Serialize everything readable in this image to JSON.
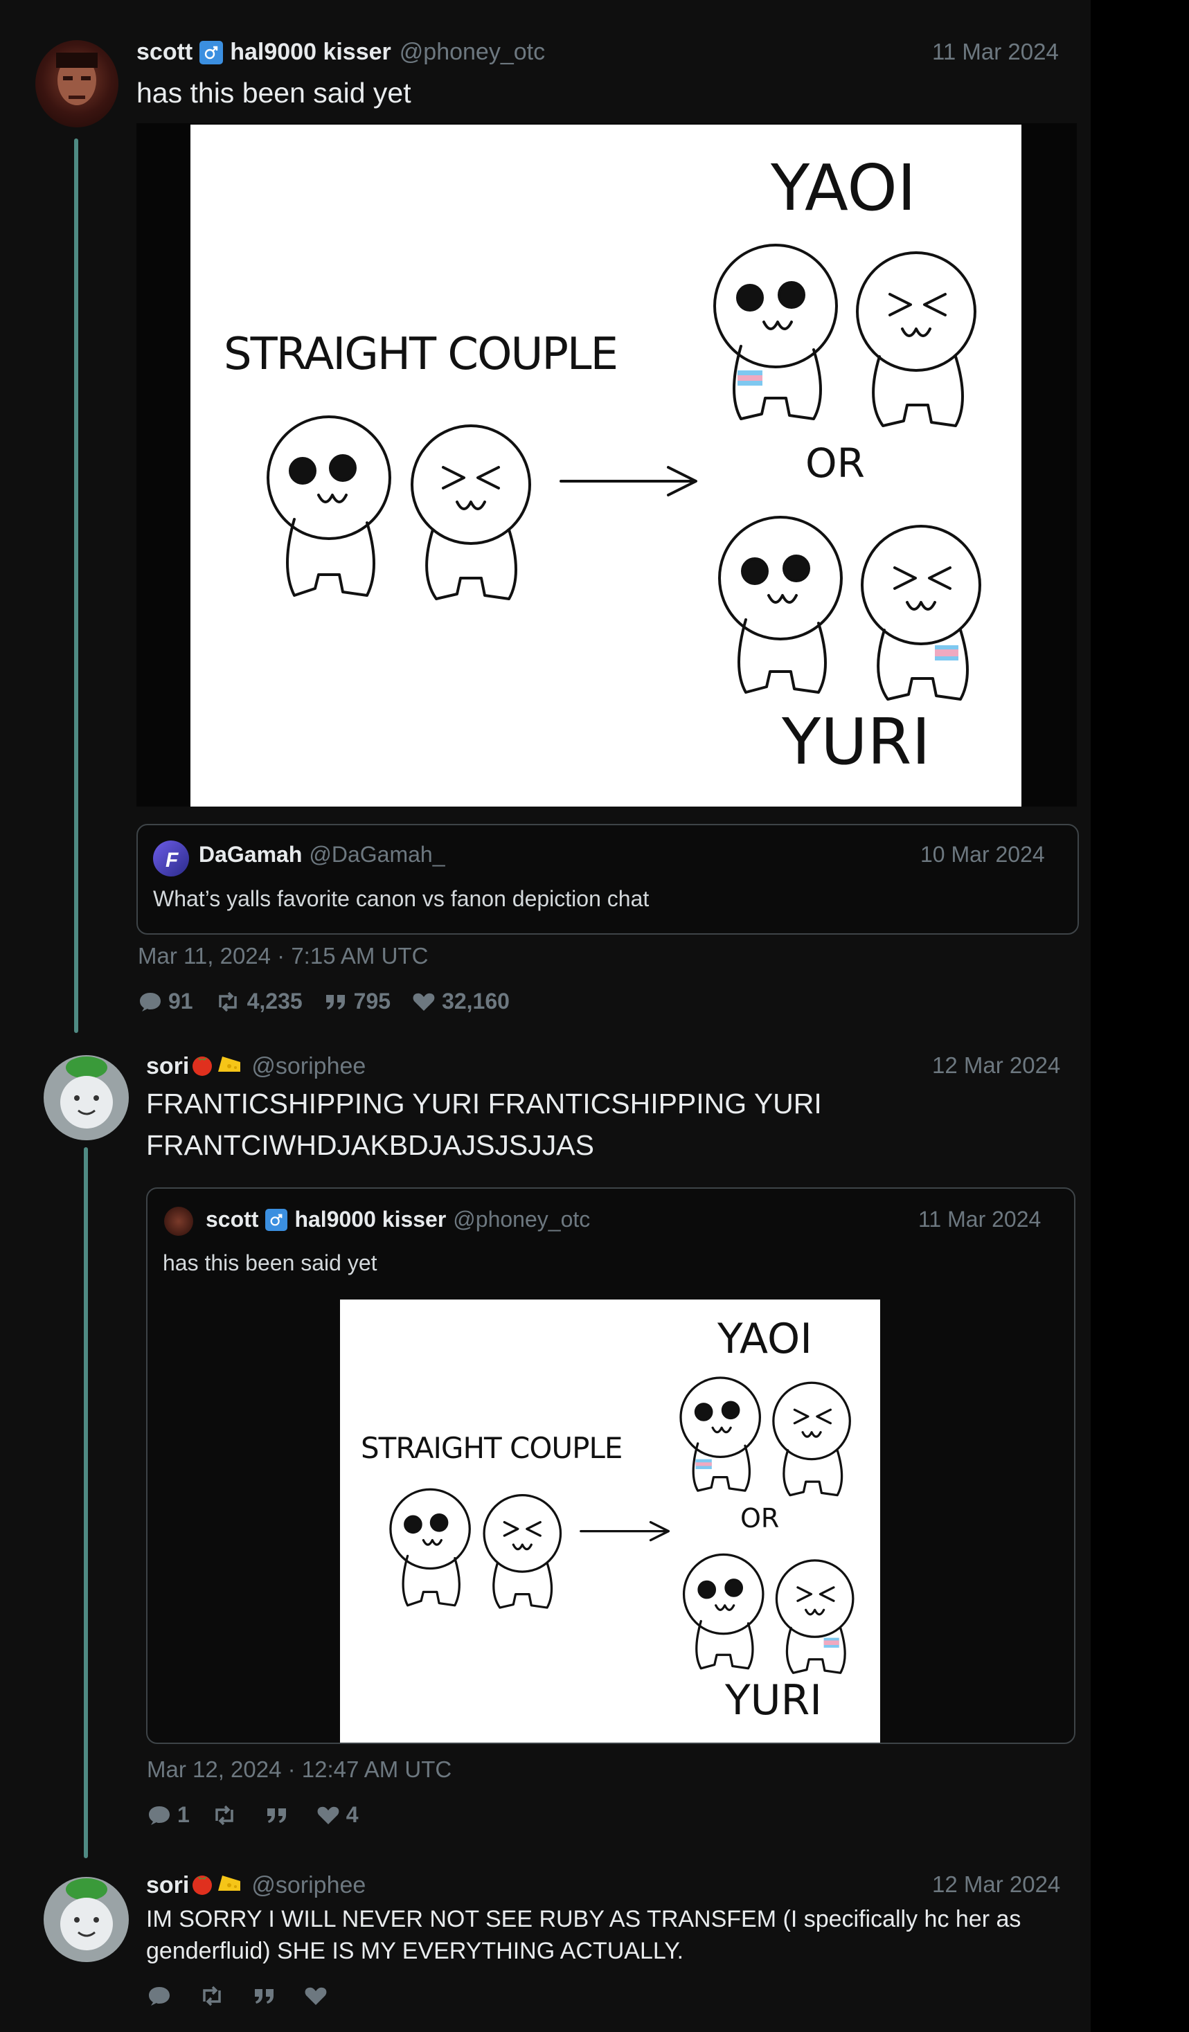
{
  "colors": {
    "background": "#0f0f0f",
    "thread_line": "#4f8a83",
    "muted": "#6d7880",
    "text": "#e9ecee"
  },
  "posts": [
    {
      "author_name": "scott",
      "author_name_suffix": "hal9000 kisser",
      "handle": "@phoney_otc",
      "date": "11 Mar 2024",
      "text": "has this been said yet",
      "image_text": {
        "straight": "STRAIGHT COUPLE",
        "yaoi": "YAOI",
        "or": "OR",
        "yuri": "YURI"
      },
      "quote": {
        "author_name": "DaGamah",
        "handle": "@DaGamah_",
        "date": "10 Mar 2024",
        "text": "What’s yalls favorite canon vs fanon depiction chat"
      },
      "timestamp": "Mar 11, 2024 · 7:15 AM UTC",
      "stats": {
        "replies": "91",
        "retweets": "4,235",
        "quotes": "795",
        "likes": "32,160"
      }
    },
    {
      "author_name": "sori",
      "handle": "@soriphee",
      "date": "12 Mar 2024",
      "text": "FRANTICSHIPPING YURI FRANTICSHIPPING YURI\nFRANTCIWHDJAKBDJAJSJSJJAS",
      "quote": {
        "author_name": "scott",
        "author_name_suffix": "hal9000 kisser",
        "handle": "@phoney_otc",
        "date": "11 Mar 2024",
        "text": "has this been said yet"
      },
      "timestamp": "Mar 12, 2024 · 12:47 AM UTC",
      "stats": {
        "replies": "1",
        "retweets": "",
        "quotes": "",
        "likes": "4"
      }
    },
    {
      "author_name": "sori",
      "handle": "@soriphee",
      "date": "12 Mar 2024",
      "text": "IM SORRY I WILL NEVER NOT SEE RUBY AS TRANSFEM (I specifically hc her as\ngenderfluid) SHE IS MY EVERYTHING ACTUALLY.",
      "stats": {
        "replies": "",
        "retweets": "",
        "quotes": "",
        "likes": ""
      }
    }
  ]
}
